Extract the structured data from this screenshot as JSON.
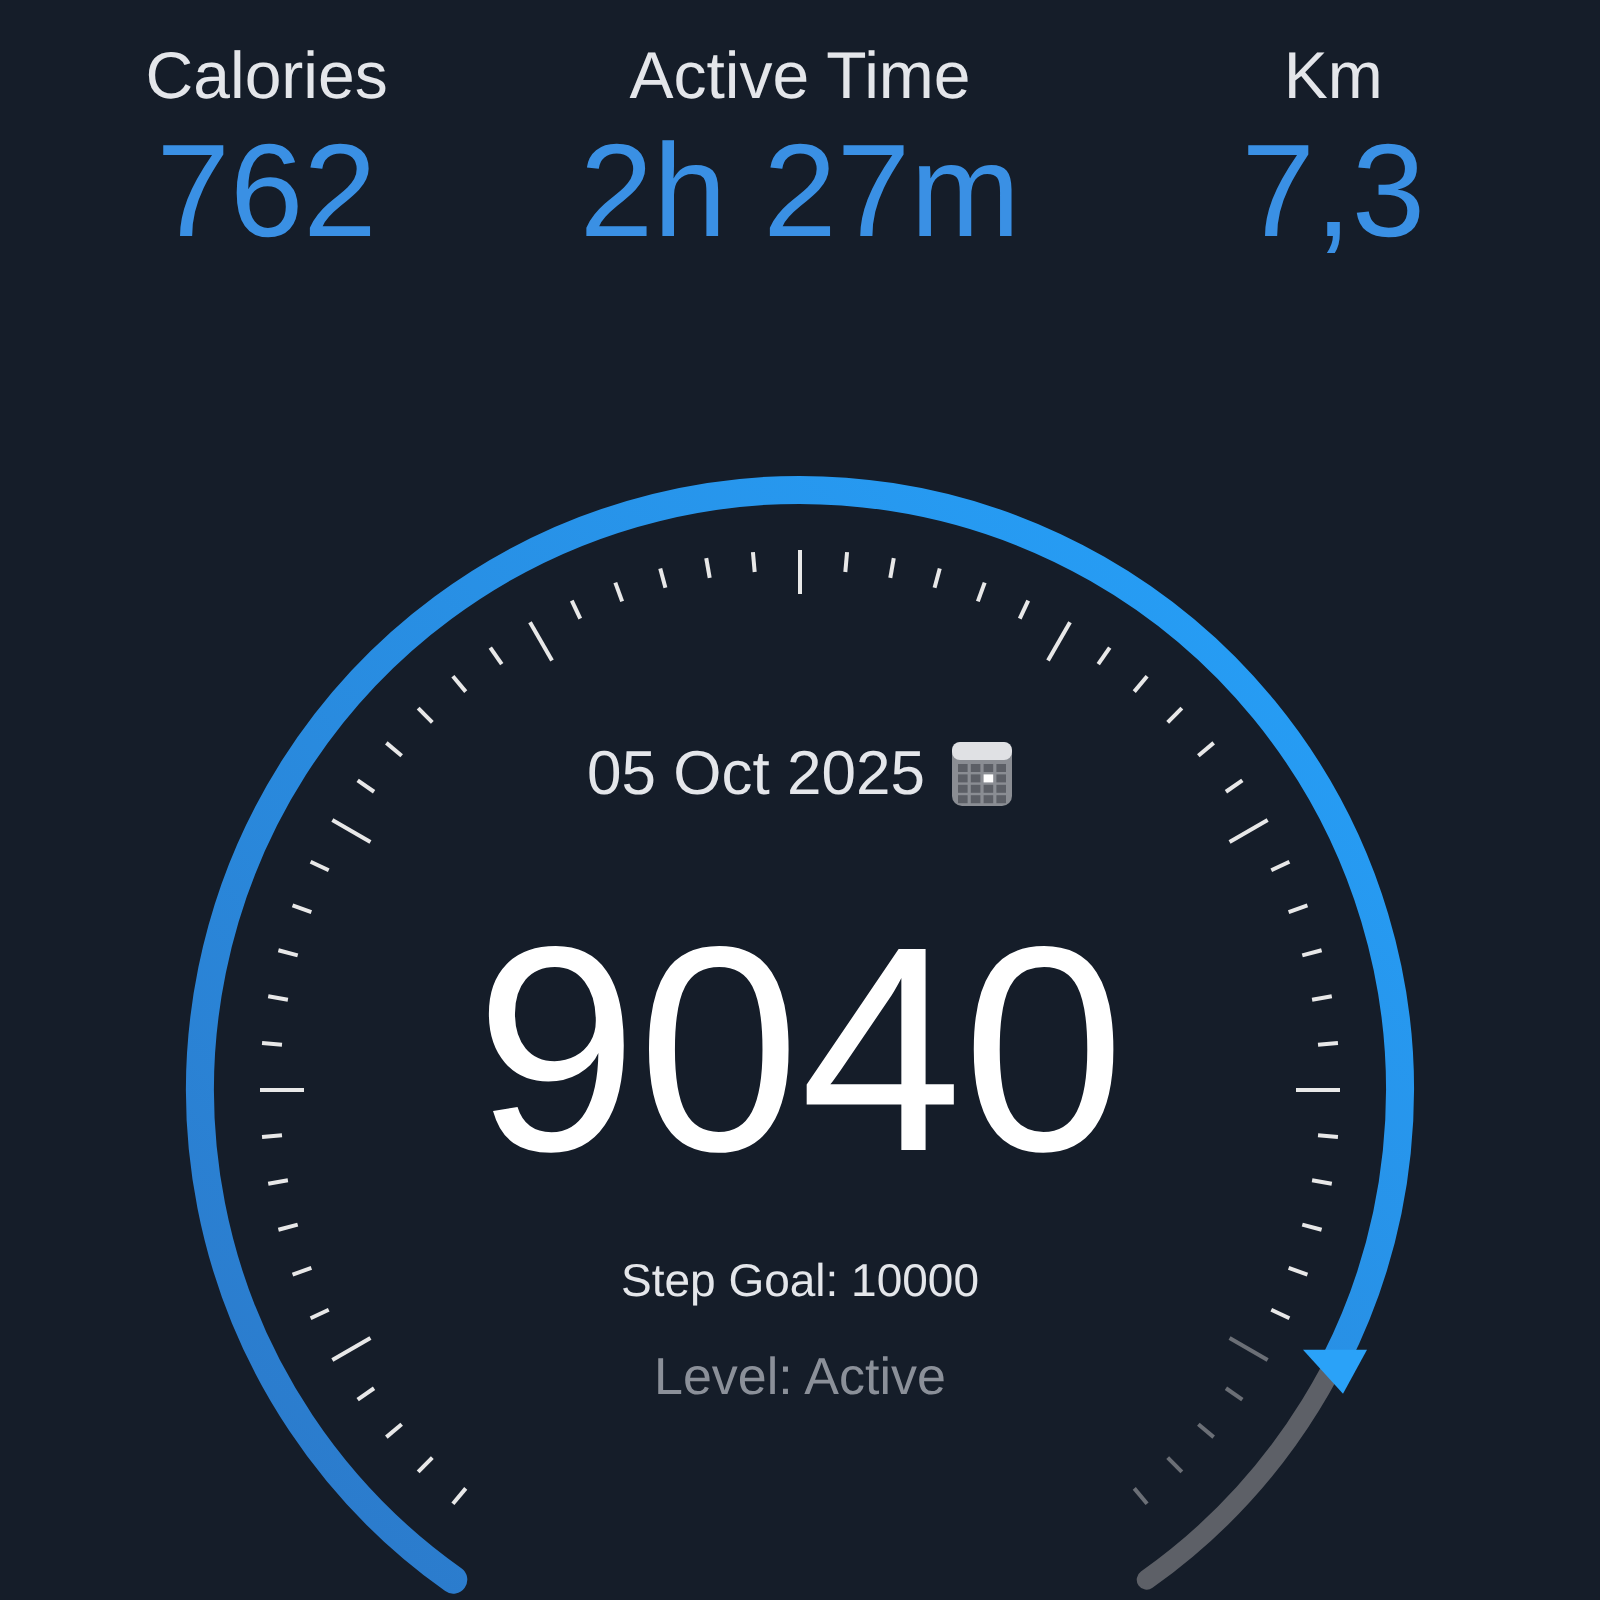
{
  "stats": [
    {
      "label": "Calories",
      "value": "762"
    },
    {
      "label": "Active Time",
      "value": "2h 27m"
    },
    {
      "label": "Km",
      "value": "7,3"
    }
  ],
  "gauge": {
    "date": "05 Oct 2025",
    "steps": "9040",
    "step_goal": "Step Goal: 10000",
    "activity_level": "Level: Active"
  }
}
